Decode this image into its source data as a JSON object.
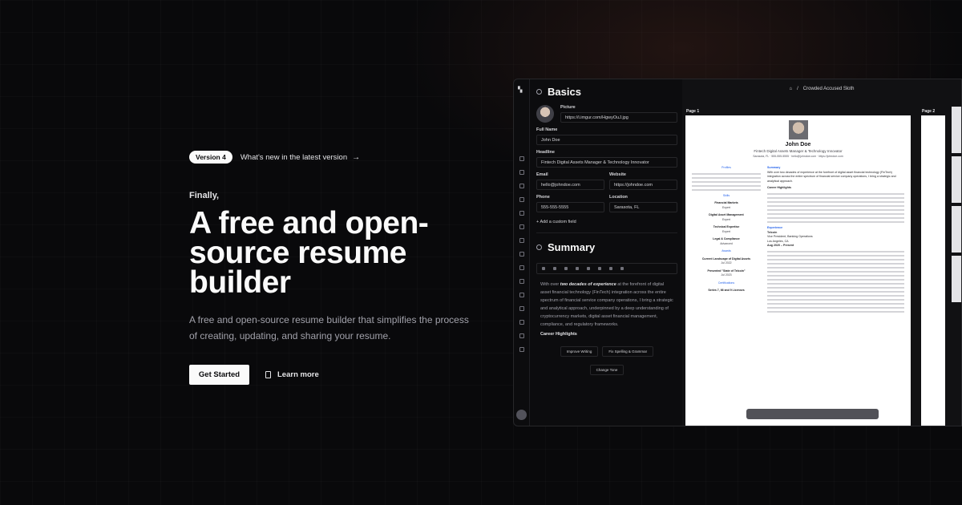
{
  "hero": {
    "badge": "Version 4",
    "whats_new": "What's new in the latest version",
    "eyebrow": "Finally,",
    "headline": "A free and open-source resume builder",
    "subtext": "A free and open-source resume builder that simplifies the process of creating, updating, and sharing your resume.",
    "cta_primary": "Get Started",
    "cta_secondary": "Learn more"
  },
  "app": {
    "breadcrumb": "Crowded Accused Sloth",
    "basics": {
      "title": "Basics",
      "picture_label": "Picture",
      "picture_url": "https://i.imgur.com/HgwyOuJ.jpg",
      "fullname_label": "Full Name",
      "fullname": "John Doe",
      "headline_label": "Headline",
      "headline": "Fintech Digital Assets Manager & Technology Innovator",
      "email_label": "Email",
      "email": "hello@johndoe.com",
      "website_label": "Website",
      "website": "https://johndoe.com",
      "phone_label": "Phone",
      "phone": "555-555-5555",
      "location_label": "Location",
      "location": "Sarasota, FL",
      "add_field": "Add a custom field"
    },
    "summary": {
      "title": "Summary",
      "text_pre": "With over ",
      "text_bold": "two decades of experience",
      "text_post": " at the forefront of digital asset financial technology (FinTech) integration across the entire spectrum of financial service company operations, I bring a strategic and analytical approach, underpinned by a deep understanding of cryptocurrency markets, digital asset financial management, compliance, and regulatory frameworks.",
      "highlights": "Career Highlights",
      "ai_improve": "Improve Writing",
      "ai_fix": "Fix Spelling & Grammar",
      "ai_tone": "Change Tone"
    },
    "preview": {
      "page1": "Page 1",
      "page2": "Page 2",
      "name": "John Doe",
      "role": "Fintech Digital Assets Manager & Technology Innovator",
      "contact": "Sarasota, FL  ·  555-555-5555  ·  hello@johndoe.com  ·  https://johndoe.com",
      "left_profiles": "Profiles",
      "left_skills": "Skills",
      "skill1": "Financial Markets",
      "skill1_level": "Expert",
      "skill2": "Digital Asset Management",
      "skill2_level": "Expert",
      "skill3": "Technical Expertise",
      "skill3_level": "Expert",
      "skill4": "Legal & Compliance",
      "skill4_level": "Advanced",
      "awards": "Awards",
      "award1": "Current Landscape of Digital Assets",
      "award1_date": "Jul 2022",
      "award2": "Presented \"State of Telcoin\"",
      "award2_date": "Jul 2023",
      "certs": "Certifications",
      "cert1": "Series 7, 66 and 9 Licenses",
      "summary_h": "Summary",
      "summary_line": "With over two decades of experience at the forefront of digital asset financial technology (FinTech) integration across the entire spectrum of financial service company operations, I bring a strategic and analytical approach.",
      "career_h": "Career Highlights",
      "experience_h": "Experience",
      "company": "Telcoin",
      "position": "Vice President, Banking Operations",
      "company_loc": "Los Angeles, CA",
      "company_date": "Aug 2020 – Present"
    }
  }
}
